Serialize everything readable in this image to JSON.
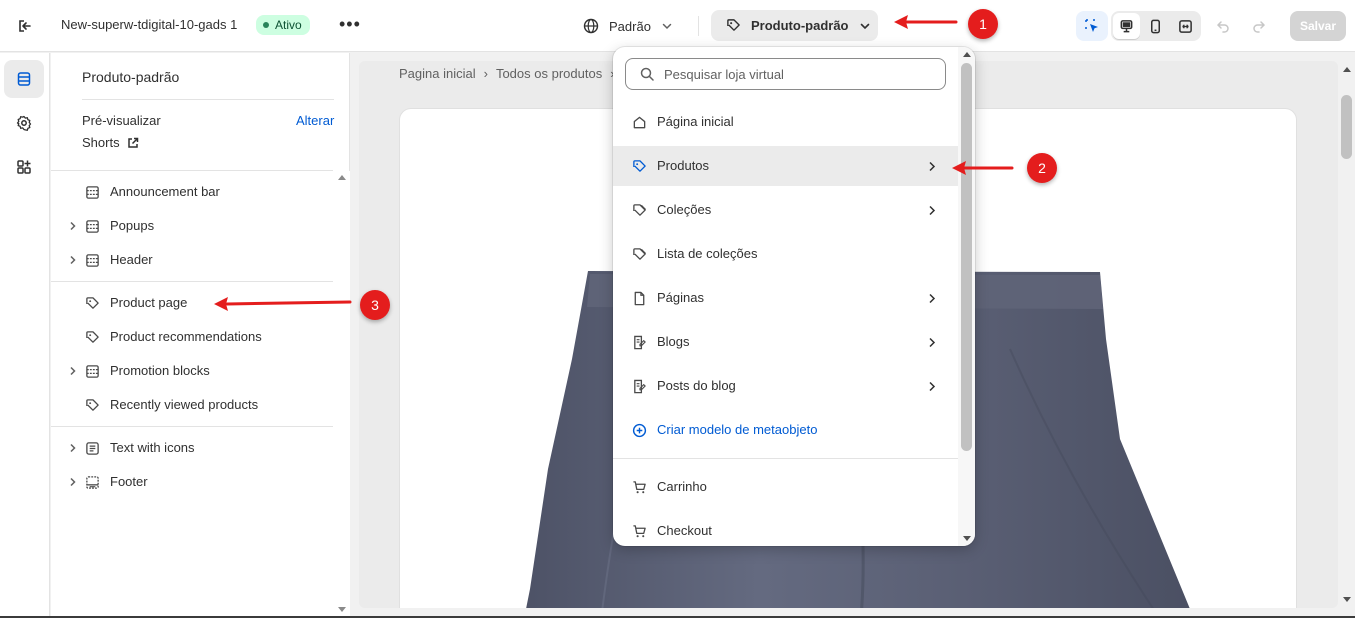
{
  "topbar": {
    "store_name": "New-superw-tdigital-10-gads 1",
    "status_badge": "Ativo",
    "more_label": "•••",
    "language": "Padrão",
    "template": "Produto-padrão",
    "save_label": "Salvar"
  },
  "sidebar": {
    "title": "Produto-padrão",
    "preview_label": "Pré-visualizar",
    "change_label": "Alterar",
    "preview_product": "Shorts",
    "items": [
      {
        "label": "Announcement bar",
        "icon": "section-icon",
        "expandable": false
      },
      {
        "label": "Popups",
        "icon": "section-icon",
        "expandable": true
      },
      {
        "label": "Header",
        "icon": "section-icon",
        "expandable": true
      },
      {
        "label": "Product page",
        "icon": "tag-icon",
        "expandable": false
      },
      {
        "label": "Product recommendations",
        "icon": "tag-icon",
        "expandable": false
      },
      {
        "label": "Promotion blocks",
        "icon": "section-icon",
        "expandable": true
      },
      {
        "label": "Recently viewed products",
        "icon": "tag-icon",
        "expandable": false
      },
      {
        "label": "Text with icons",
        "icon": "text-block-icon",
        "expandable": true
      },
      {
        "label": "Footer",
        "icon": "footer-icon",
        "expandable": true
      }
    ]
  },
  "preview": {
    "breadcrumb": [
      "Pagina inicial",
      "›",
      "Todos os produtos",
      "›"
    ]
  },
  "dropdown": {
    "search_placeholder": "Pesquisar loja virtual",
    "items": [
      {
        "label": "Página inicial",
        "icon": "home-icon",
        "submenu": false
      },
      {
        "label": "Produtos",
        "icon": "tag-icon",
        "submenu": true,
        "highlighted": true
      },
      {
        "label": "Coleções",
        "icon": "collection-icon",
        "submenu": true
      },
      {
        "label": "Lista de coleções",
        "icon": "collection-icon",
        "submenu": false
      },
      {
        "label": "Páginas",
        "icon": "page-icon",
        "submenu": true
      },
      {
        "label": "Blogs",
        "icon": "blog-icon",
        "submenu": true
      },
      {
        "label": "Posts do blog",
        "icon": "blog-icon",
        "submenu": true
      },
      {
        "label": "Criar modelo de metaobjeto",
        "icon": "plus-circle-icon",
        "submenu": false,
        "accent": true
      },
      {
        "label": "Carrinho",
        "icon": "cart-icon",
        "submenu": false
      },
      {
        "label": "Checkout",
        "icon": "cart-icon",
        "submenu": false
      }
    ]
  },
  "annotations": [
    "1",
    "2",
    "3"
  ],
  "colors": {
    "accent": "#005bd3",
    "annotation_red": "#e41d1d",
    "active_badge_bg": "#cdfee1",
    "product_fabric": "#5b6075"
  }
}
